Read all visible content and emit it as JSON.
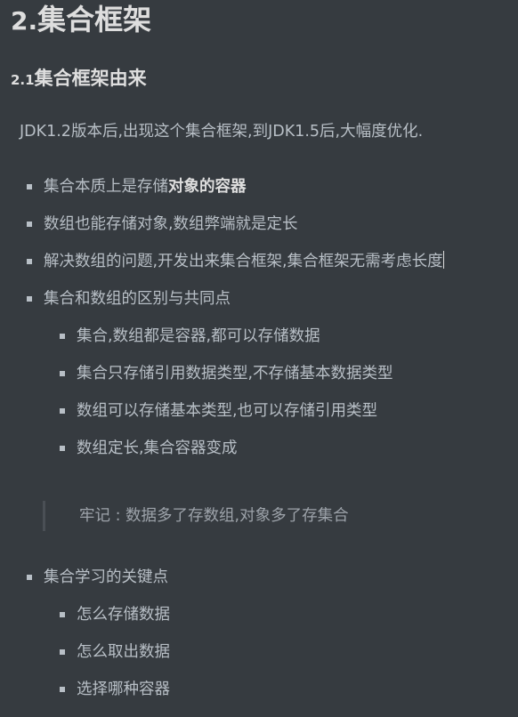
{
  "heading": {
    "number": "2.",
    "title": "集合框架"
  },
  "subheading": {
    "number": "2.1",
    "title": "集合框架由来"
  },
  "intro": "JDK1.2版本后,出现这个集合框架,到JDK1.5后,大幅度优化.",
  "list1": [
    {
      "text_plain": "集合本质上是存储",
      "text_bold": "对象的容器"
    },
    {
      "text": "数组也能存储对象,数组弊端就是定长"
    },
    {
      "text": "解决数组的问题,开发出来集合框架,集合框架无需考虑长度"
    },
    {
      "text": "集合和数组的区别与共同点"
    }
  ],
  "list1_sub": [
    "集合,数组都是容器,都可以存储数据",
    "集合只存储引用数据类型,不存储基本数据类型",
    "数组可以存储基本类型,也可以存储引用类型",
    "数组定长,集合容器变成"
  ],
  "blockquote": "牢记 : 数据多了存数组,对象多了存集合",
  "list2": {
    "text": "集合学习的关键点",
    "sub": [
      "怎么存储数据",
      "怎么取出数据",
      "选择哪种容器"
    ]
  }
}
